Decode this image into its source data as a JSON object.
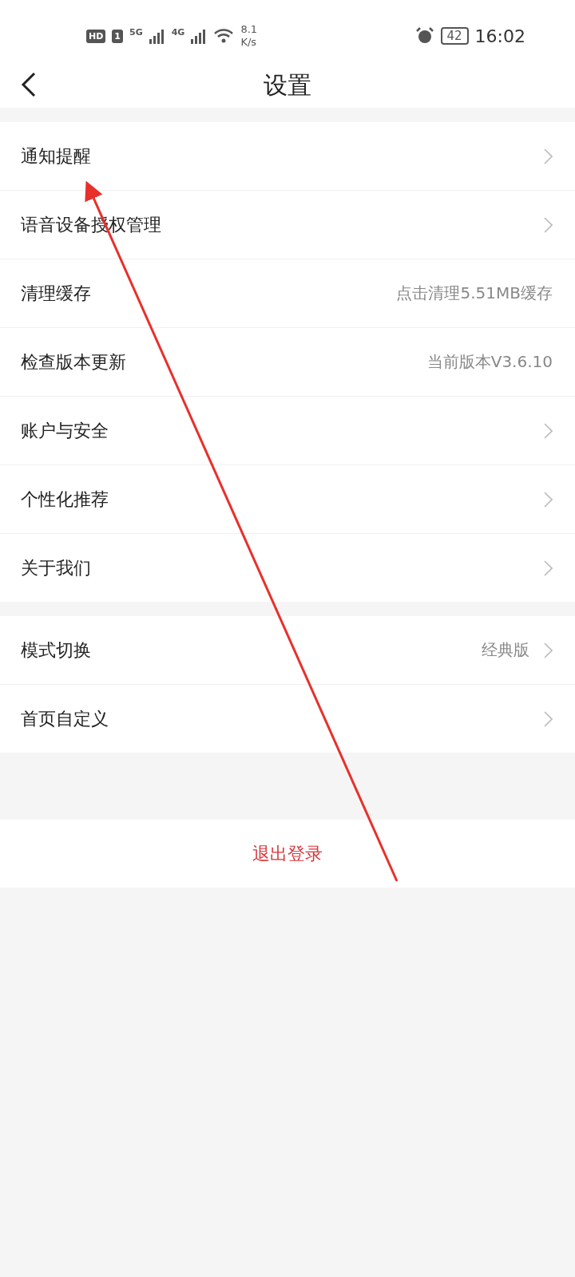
{
  "status_bar": {
    "hd": "HD",
    "sim": "1",
    "net1": "5G",
    "net2": "4G",
    "speed_value": "8.1",
    "speed_unit": "K/s",
    "battery": "42",
    "time": "16:02"
  },
  "header": {
    "title": "设置"
  },
  "groups": [
    {
      "items": [
        {
          "label": "通知提醒",
          "chevron": true
        },
        {
          "label": "语音设备授权管理",
          "chevron": true
        },
        {
          "label": "清理缓存",
          "value": "点击清理5.51MB缓存",
          "chevron": false
        },
        {
          "label": "检查版本更新",
          "value": "当前版本V3.6.10",
          "chevron": false
        },
        {
          "label": "账户与安全",
          "chevron": true
        },
        {
          "label": "个性化推荐",
          "chevron": true
        },
        {
          "label": "关于我们",
          "chevron": true
        }
      ]
    },
    {
      "items": [
        {
          "label": "模式切换",
          "value": "经典版",
          "chevron": true
        },
        {
          "label": "首页自定义",
          "chevron": true
        }
      ]
    }
  ],
  "logout": {
    "label": "退出登录"
  }
}
